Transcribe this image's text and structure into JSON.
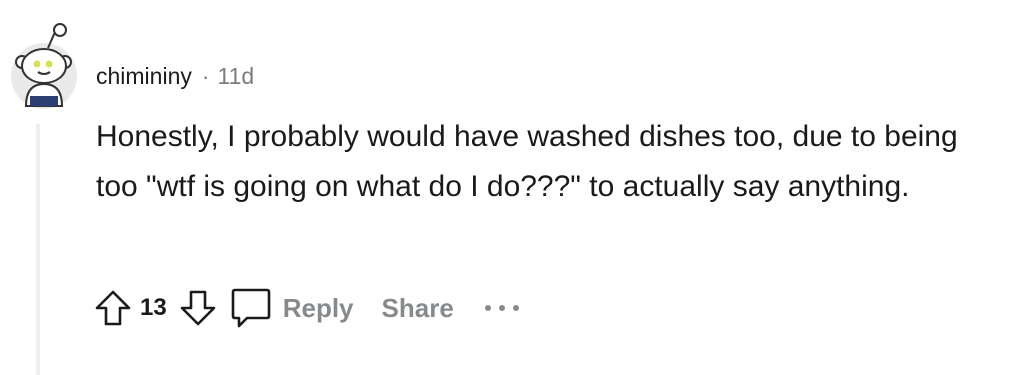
{
  "comment": {
    "username": "chimininy",
    "separator": "·",
    "age": "11d",
    "body": "Honestly, I probably would have washed dishes too, due to being too \"wtf is going on what do I do???\" to actually say anything.",
    "score": "13"
  },
  "actions": {
    "reply_label": "Reply",
    "share_label": "Share",
    "more_icon": "more-horizontal-icon",
    "upvote_icon": "arrow-up-icon",
    "downvote_icon": "arrow-down-icon",
    "comment_icon": "speech-bubble-icon"
  },
  "colors": {
    "text": "#1a1a1b",
    "muted": "#878a8c",
    "thread_line": "#edeff1"
  }
}
